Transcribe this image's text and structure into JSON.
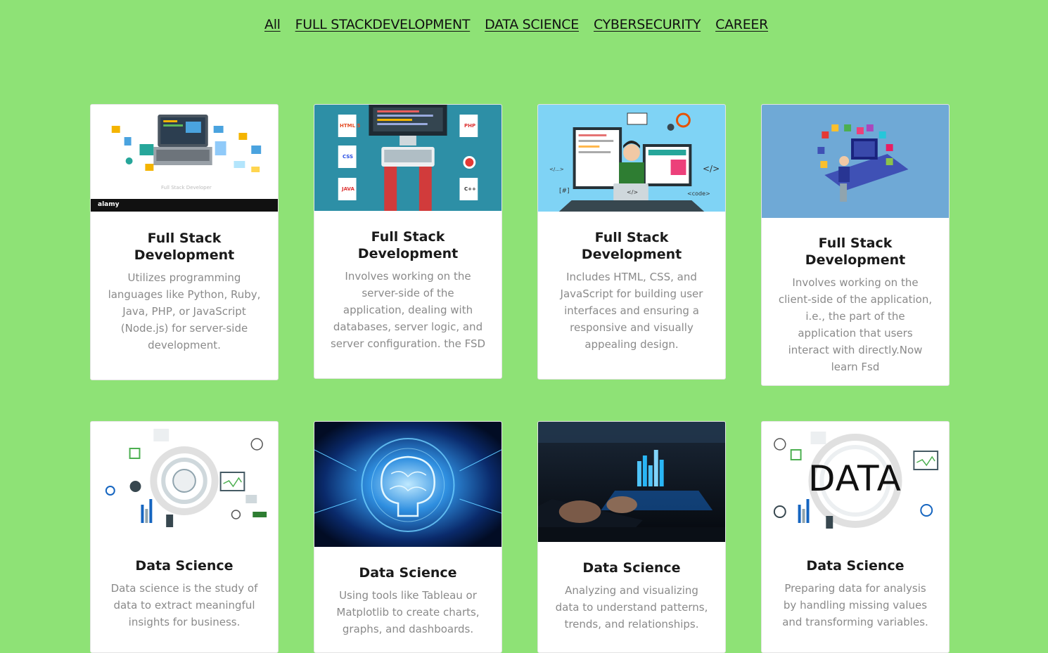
{
  "nav": [
    "All",
    "FULL STACKDEVELOPMENT",
    "DATA SCIENCE",
    "CYBERSECURITY",
    "CAREER"
  ],
  "cards": [
    {
      "title": "Full Stack Development",
      "text": "Utilizes programming languages like Python, Ruby, Java, PHP, or JavaScript (Node.js) for server-side development.",
      "image": "fsd-laptop-diagram",
      "brand": "alamy",
      "caption": "Full Stack Developer"
    },
    {
      "title": "Full Stack Development",
      "text": "Involves working on the server-side of the application, dealing with databases, server logic, and server configuration. the FSD",
      "image": "fsd-keyboard-hands",
      "labels": [
        "HTML 5",
        "CSS",
        "JAVA",
        "PHP",
        "C++"
      ]
    },
    {
      "title": "Full Stack Development",
      "text": "Includes HTML, CSS, and JavaScript for building user interfaces and ensuring a responsive and visually appealing design.",
      "image": "fsd-developer-monitors",
      "labels": [
        "</...>",
        "[#]",
        "</>",
        "<code>",
        "</>"
      ]
    },
    {
      "title": "Full Stack Development",
      "text": "Involves working on the client-side of the application, i.e., the part of the application that users interact with directly.Now learn Fsd",
      "image": "fsd-isometric-desk"
    },
    {
      "title": "Data Science",
      "text": "Data science is the study of data to extract meaningful insights for business.",
      "image": "ds-infographic"
    },
    {
      "title": "Data Science",
      "text": "Using tools like Tableau or Matplotlib to create charts, graphs, and dashboards.",
      "image": "ds-ai-brain"
    },
    {
      "title": "Data Science",
      "text": "Analyzing and visualizing data to understand patterns, trends, and relationships.",
      "image": "ds-laptop-hologram"
    },
    {
      "title": "Data Science",
      "text": "Preparing data for analysis by handling missing values and transforming variables.",
      "image": "ds-data-word",
      "word": "DATA"
    }
  ]
}
